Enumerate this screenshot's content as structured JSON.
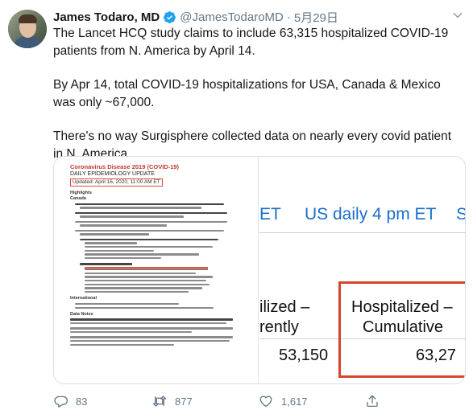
{
  "tweet": {
    "author_name": "James Todaro, MD",
    "handle": "@JamesTodaroMD",
    "separator": "·",
    "date": "5月29日",
    "paragraphs": [
      "The Lancet HCQ study claims to include 63,315 hospitalized COVID-19 patients from N. America by April 14.",
      "By Apr 14, total COVID-19 hospitalizations for USA, Canada & Mexico was only ~67,000.",
      "There's no way Surgisphere collected data on nearly every covid patient in N. America."
    ]
  },
  "media_left": {
    "title": "Coronavirus Disease 2019 (COVID-19)",
    "subtitle": "DAILY EPIDEMIOLOGY UPDATE",
    "updated": "Updated: April 16, 2020, 11:00 AM ET",
    "sections": [
      "Highlights",
      "Canada",
      "International",
      "Data Notes"
    ]
  },
  "media_right": {
    "header_left": "ET",
    "header_main": "US daily 4 pm ET",
    "header_right": "S",
    "col1_line1": "ilized –",
    "col1_line2": "rently",
    "col2_line1": "Hospitalized –",
    "col2_line2": "Cumulative",
    "val1": "53,150",
    "val2": "63,27"
  },
  "actions": {
    "replies": "83",
    "retweets": "877",
    "likes": "1,617"
  },
  "colors": {
    "verified": "#1da1f2",
    "link_blue": "#1a6fcb",
    "highlight_red": "#d9442c"
  }
}
